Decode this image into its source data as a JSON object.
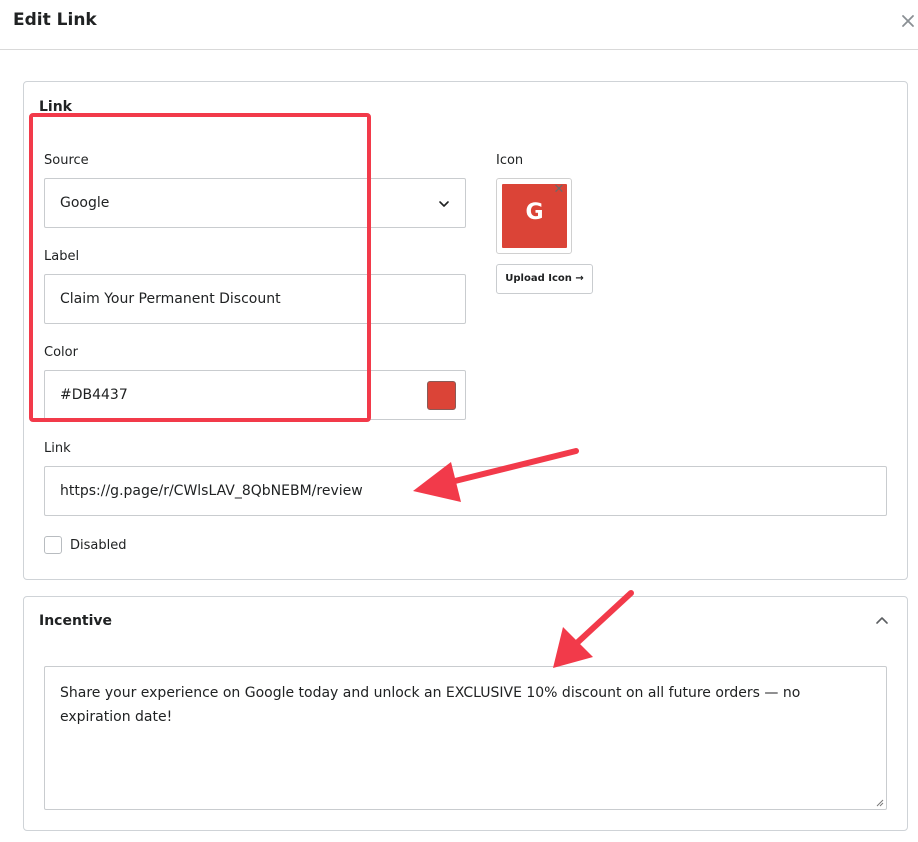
{
  "dialog": {
    "title": "Edit Link"
  },
  "link_section": {
    "title": "Link",
    "source": {
      "label": "Source",
      "value": "Google"
    },
    "label_field": {
      "label": "Label",
      "value": "Claim Your Permanent Discount"
    },
    "color": {
      "label": "Color",
      "value": "#DB4437"
    },
    "icon": {
      "label": "Icon",
      "letter": "G",
      "upload_label": "Upload Icon →"
    },
    "link": {
      "label": "Link",
      "value": "https://g.page/r/CWlsLAV_8QbNEBM/review"
    },
    "disabled": {
      "label": "Disabled",
      "checked": false
    }
  },
  "incentive_section": {
    "title": "Incentive",
    "text": "Share your experience on Google today and unlock an EXCLUSIVE 10% discount on all future orders — no expiration date!"
  },
  "colors": {
    "brand_red": "#DB4437",
    "annotation_red": "#F23A4A"
  },
  "icons": [
    "close-icon",
    "chevron-down-icon",
    "chevron-up-icon",
    "resize-grip-icon"
  ]
}
